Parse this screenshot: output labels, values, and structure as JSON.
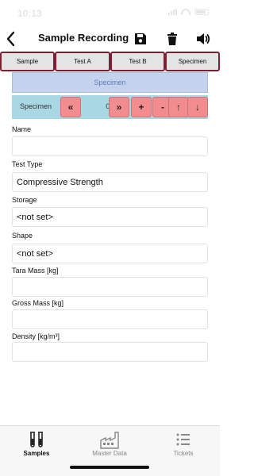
{
  "status_bar": {
    "time": "10:13"
  },
  "header": {
    "title": "Sample Recording"
  },
  "tabs": [
    {
      "label": "Sample"
    },
    {
      "label": "Test A"
    },
    {
      "label": "Test B"
    },
    {
      "label": "Specimen"
    }
  ],
  "section": {
    "title": "Specimen"
  },
  "navigator": {
    "label": "Specimen",
    "counter": "0 / 0",
    "first": "«",
    "last": "»",
    "add": "+",
    "remove": "-",
    "up": "↑",
    "down": "↓"
  },
  "form": {
    "name": {
      "label": "Name",
      "value": ""
    },
    "test_type": {
      "label": "Test Type",
      "value": "Compressive Strength"
    },
    "storage": {
      "label": "Storage",
      "value": "<not set>"
    },
    "shape": {
      "label": "Shape",
      "value": "<not set>"
    },
    "tara_mass": {
      "label": "Tara Mass [kg]",
      "value": ""
    },
    "gross_mass": {
      "label": "Gross Mass [kg]",
      "value": ""
    },
    "density": {
      "label": "Density [kg/m³]",
      "value": ""
    }
  },
  "tabbar": {
    "items": [
      {
        "label": "Samples",
        "icon": "test-tubes-icon",
        "active": true
      },
      {
        "label": "Master Data",
        "icon": "factory-icon",
        "active": false
      },
      {
        "label": "Tickets",
        "icon": "list-icon",
        "active": false
      }
    ]
  },
  "colors": {
    "tab_border": "#7b2133",
    "section_bg": "#c5d2ee",
    "navigator_bg": "#a9d7e3",
    "nav_button_bg": "#f28c8f"
  }
}
